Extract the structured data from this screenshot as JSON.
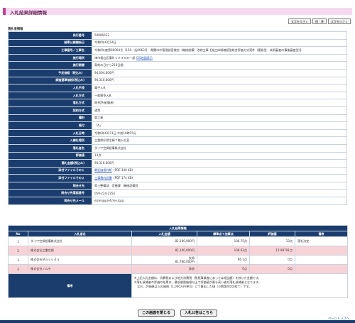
{
  "page": {
    "title": "入札結果詳細情報"
  },
  "font_controls": [
    "文字を大きく",
    "標　準",
    "文字を小さく"
  ],
  "section": "落札者情報",
  "info_rows": [
    {
      "label": "発行番号",
      "value": "50006023"
    },
    {
      "label": "結果公開開始日",
      "value": "令和6年6月14日"
    },
    {
      "label": "工事番号／工事名",
      "value": "令和6年度第60004号（150一括0063号　貴関市中管理部室検討（機械設備）改修工事【施工体制確認型総合評価方式案件（簡易型・技術審査の事後審査型）】"
    },
    {
      "label": "施行場所",
      "value": "津市相山区東町１２３９の一部",
      "link": "GIS地図表示"
    },
    {
      "label": "施行期間",
      "value": "契約の日から210日間"
    },
    {
      "label": "予定価格（税込み）",
      "value": "94,004,600円"
    },
    {
      "label": "調査基準価格(税込み)",
      "value": "90,310,000円"
    },
    {
      "label": "入札手段",
      "value": "電子入札"
    },
    {
      "label": "入札方式",
      "value": "一般競争入札"
    },
    {
      "label": "落札方式",
      "value": "総合評価(簡易)"
    },
    {
      "label": "契約方式",
      "value": "通常"
    },
    {
      "label": "種別",
      "value": "管工事"
    },
    {
      "label": "格付",
      "value": "「A」"
    },
    {
      "label": "入札日時",
      "value": "令和6年6月11日 午前10時15分"
    },
    {
      "label": "入開札場所",
      "value": "三重県庁県生棟７階入札室"
    },
    {
      "label": "落札者名",
      "value": "ダイワ空調設備株式会社"
    },
    {
      "label": "評価値",
      "value": "13点"
    },
    {
      "label": "落札金額(税込み)",
      "value": "90,310,000円"
    },
    {
      "label": "添付ファイルその１",
      "link": "最低価格判断",
      "value": "（PDF 340 KB)"
    },
    {
      "label": "添付ファイルその２",
      "link": "工事費内訳書",
      "value": "（PDF 174 KB)"
    },
    {
      "label": "問合せ先",
      "value": "県土整備部　営繕課　機械設備班"
    },
    {
      "label": "問合せ先電話番号",
      "value": "059-224-2354"
    },
    {
      "label": "問合せ先メール",
      "value": "eizen@pref.mie.lg.jp"
    }
  ],
  "results": {
    "caption": "入札結果情報",
    "headers": [
      "No",
      "入札者名",
      "入札金額",
      "標準点＋加算点",
      "評価値",
      "備考"
    ],
    "rows": [
      {
        "no": "1",
        "name": "ダイワ空調設備株式会社",
        "amount": "82,100,000円",
        "points": "106.75点",
        "eval": "13点",
        "note": "落札決定",
        "color": "#ffffff"
      },
      {
        "no": "2",
        "name": "株式会社三重空調",
        "amount": "82,100,000円",
        "points": "108.63点",
        "eval": "12.98791点",
        "note": "",
        "color": "#f7d3d8"
      },
      {
        "no": "3",
        "name": "株式会社Ｍａｓｕｄａ",
        "amount_line1": "失格",
        "amount": "81,780,000円",
        "points": "96.1点",
        "eval": "0点",
        "note": "",
        "color": "#ffffff"
      },
      {
        "no": "4",
        "name": "株式会社ノムラ",
        "amount": "辞退",
        "points": "0点",
        "eval": "0点",
        "note": "",
        "color": "#f7d3d8"
      }
    ],
    "remark_label": "備考",
    "remarks": [
      "※上記入札金額は、消費税および地方消費税（免税事業者にあっては相当額）を除いた金額です。",
      "※落札候補者の評価の結果は、最低制限価格以上で評価値が最も高い者が落札候補者となります。",
      "　なお、評価値は入札価格（1,000万円単位）にて算出した値（小数第4位切捨て）です。"
    ]
  },
  "actions": [
    "この画面を閉じる",
    "入札公告はこちら"
  ],
  "pagetop": "ページトップへ",
  "colors": {
    "header_navy": "#1b3d6e",
    "title_pink": "#f6d9f0",
    "title_accent": "#c83d9a",
    "row_pink": "#f7d3d8",
    "link_blue": "#2a58b8"
  }
}
